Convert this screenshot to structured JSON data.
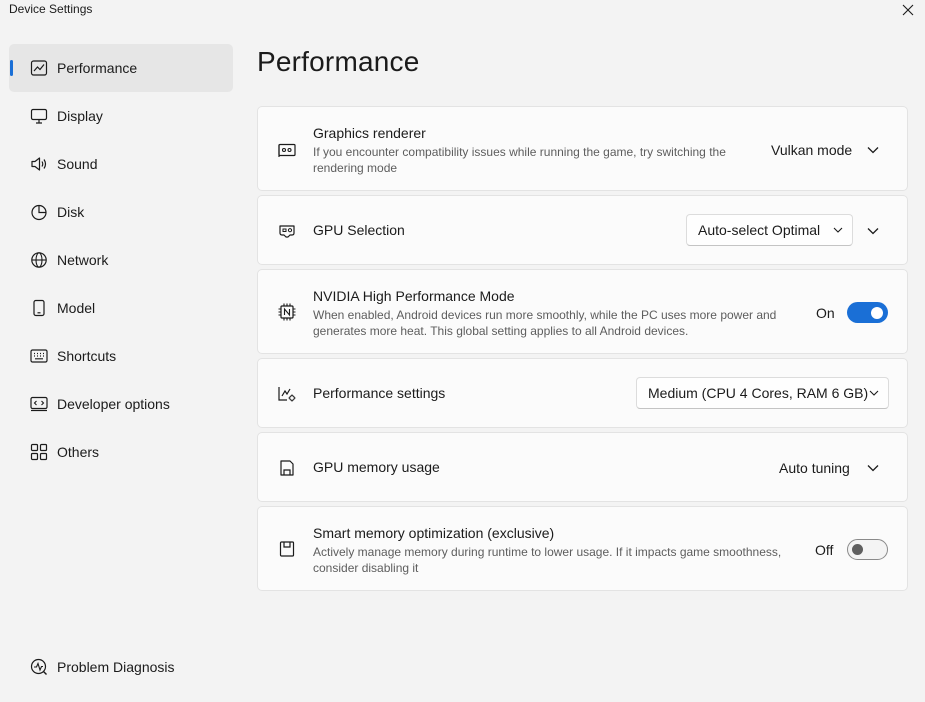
{
  "window": {
    "title": "Device Settings"
  },
  "sidebar": {
    "items": [
      {
        "label": "Performance",
        "icon": "performance-chart-icon",
        "active": true
      },
      {
        "label": "Display",
        "icon": "monitor-icon"
      },
      {
        "label": "Sound",
        "icon": "speaker-icon"
      },
      {
        "label": "Disk",
        "icon": "pie-disk-icon"
      },
      {
        "label": "Network",
        "icon": "globe-icon"
      },
      {
        "label": "Model",
        "icon": "phone-icon"
      },
      {
        "label": "Shortcuts",
        "icon": "keyboard-icon"
      },
      {
        "label": "Developer options",
        "icon": "developer-icon"
      },
      {
        "label": "Others",
        "icon": "grid-icon"
      }
    ],
    "bottom": {
      "label": "Problem Diagnosis",
      "icon": "diagnosis-icon"
    }
  },
  "main": {
    "title": "Performance",
    "cards": [
      {
        "title": "Graphics renderer",
        "desc": "If you encounter compatibility issues while running the game, try switching the rendering mode",
        "value": "Vulkan mode"
      },
      {
        "title": "GPU Selection",
        "value": "Auto-select Optimal"
      },
      {
        "title": "NVIDIA High Performance Mode",
        "desc": "When enabled, Android devices run more smoothly, while the PC uses more power and generates more heat. This global setting applies to all Android devices.",
        "toggle_label": "On",
        "toggle_on": true
      },
      {
        "title": "Performance settings",
        "value": "Medium (CPU 4 Cores, RAM 6 GB)"
      },
      {
        "title": "GPU memory usage",
        "value": "Auto tuning"
      },
      {
        "title": "Smart memory optimization (exclusive)",
        "desc": "Actively manage memory during runtime to lower usage. If it impacts game smoothness, consider disabling it",
        "toggle_label": "Off",
        "toggle_on": false
      }
    ]
  },
  "colors": {
    "accent": "#1a6fd6",
    "background": "#f3f3f3",
    "card": "#fbfbfb"
  }
}
